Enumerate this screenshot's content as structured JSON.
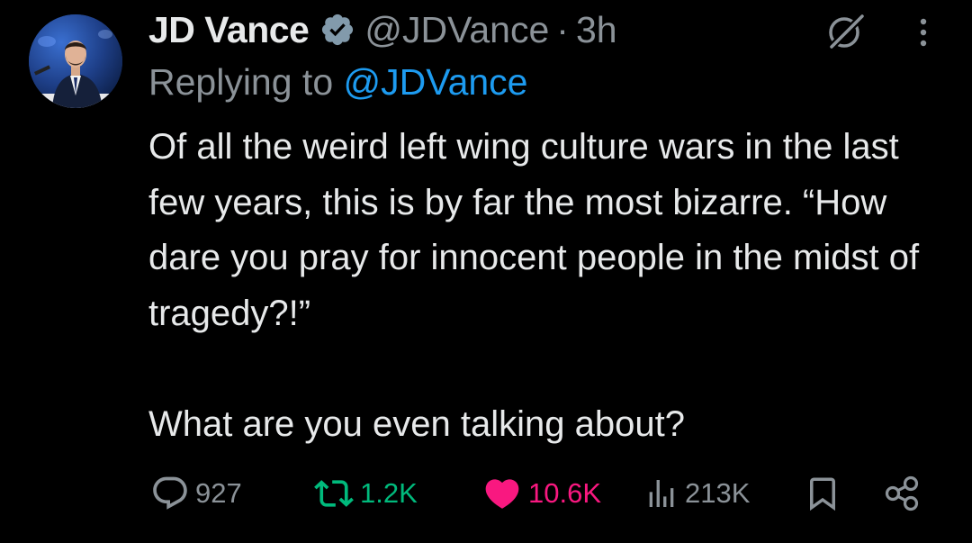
{
  "author": {
    "name": "JD Vance",
    "handle": "@JDVance",
    "separator": "·",
    "time": "3h",
    "verified": true,
    "avatar": "avatar-photo"
  },
  "reply": {
    "prefix": "Replying to",
    "mention": "@JDVance"
  },
  "body": {
    "paragraphs": [
      "Of all the weird left wing culture wars in the last few years, this is by far the most bizarre. “How dare you pray for innocent people in the midst of tragedy?!”",
      "What are you even talking about?"
    ]
  },
  "actions": {
    "replies": "927",
    "reposts": "1.2K",
    "likes": "10.6K",
    "views": "213K"
  },
  "icons": {
    "verified": "verified-badge-icon",
    "grok": "grok-icon",
    "more": "more-options-icon",
    "reply": "reply-icon",
    "repost": "repost-icon",
    "like": "heart-icon",
    "views": "views-icon",
    "bookmark": "bookmark-icon",
    "share": "share-icon"
  },
  "colors": {
    "background": "#000000",
    "text": "#e7e9ea",
    "muted": "#8b9298",
    "link": "#1d9bf0",
    "repost": "#00ba7c",
    "like": "#f91880"
  }
}
